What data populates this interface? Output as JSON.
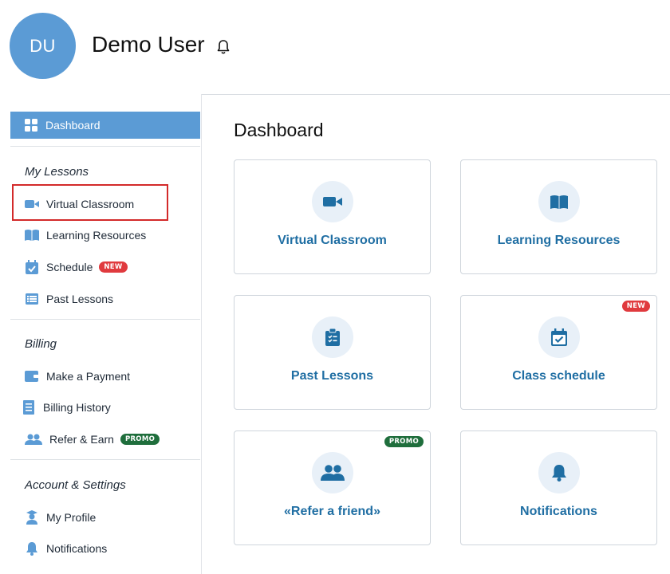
{
  "header": {
    "avatar_initials": "DU",
    "user_name": "Demo User",
    "bell_icon": "bell-icon"
  },
  "sidebar": {
    "dashboard_label": "Dashboard",
    "sections": {
      "lessons": {
        "title": "My Lessons",
        "items": [
          {
            "label": "Virtual Classroom",
            "icon": "video-camera-icon"
          },
          {
            "label": "Learning Resources",
            "icon": "book-icon"
          },
          {
            "label": "Schedule",
            "icon": "calendar-icon",
            "badge": "NEW"
          },
          {
            "label": "Past Lessons",
            "icon": "list-icon"
          }
        ]
      },
      "billing": {
        "title": "Billing",
        "items": [
          {
            "label": "Make a Payment",
            "icon": "wallet-icon"
          },
          {
            "label": "Billing History",
            "icon": "receipt-icon"
          },
          {
            "label": "Refer & Earn",
            "icon": "users-icon",
            "badge": "PROMO"
          }
        ]
      },
      "account": {
        "title": "Account & Settings",
        "items": [
          {
            "label": "My Profile",
            "icon": "graduate-icon"
          },
          {
            "label": "Notifications",
            "icon": "bell-icon"
          }
        ]
      }
    }
  },
  "main": {
    "title": "Dashboard",
    "cards": [
      {
        "label": "Virtual Classroom",
        "icon": "video-camera-icon"
      },
      {
        "label": "Learning Resources",
        "icon": "book-icon"
      },
      {
        "label": "Past Lessons",
        "icon": "clipboard-icon"
      },
      {
        "label": "Class schedule",
        "icon": "calendar-icon",
        "badge": "NEW"
      },
      {
        "label": "«Refer a friend»",
        "icon": "users-icon",
        "badge": "PROMO"
      },
      {
        "label": "Notifications",
        "icon": "bell-icon"
      }
    ]
  },
  "colors": {
    "accent": "#5b9bd5",
    "icon_blue": "#1f6ea3",
    "badge_new": "#e03a3e",
    "badge_promo": "#1f6e3c",
    "highlight": "#d32a2a"
  }
}
